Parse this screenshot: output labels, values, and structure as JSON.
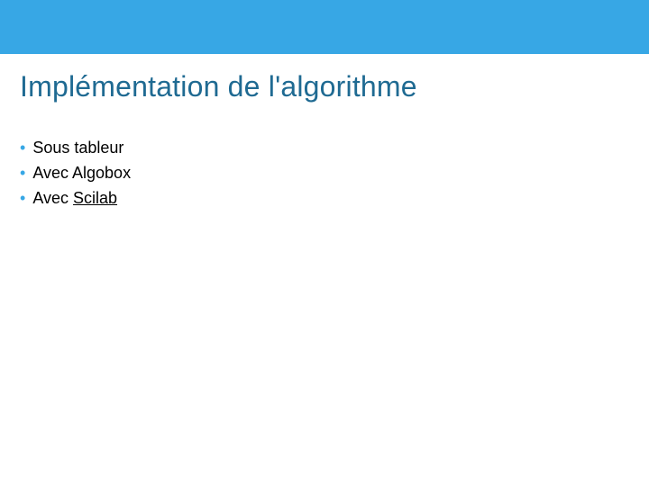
{
  "colors": {
    "accent": "#37a7e5",
    "heading": "#1f6a92",
    "bullet": "#37a7e5",
    "text": "#000000"
  },
  "slide": {
    "title": "Implémentation de l'algorithme",
    "bullets": [
      {
        "prefix": "Sous ",
        "body": "tableur",
        "link": false
      },
      {
        "prefix": "Avec ",
        "body": "Algobox",
        "link": false
      },
      {
        "prefix": "Avec ",
        "body": "Scilab",
        "link": true
      }
    ]
  }
}
